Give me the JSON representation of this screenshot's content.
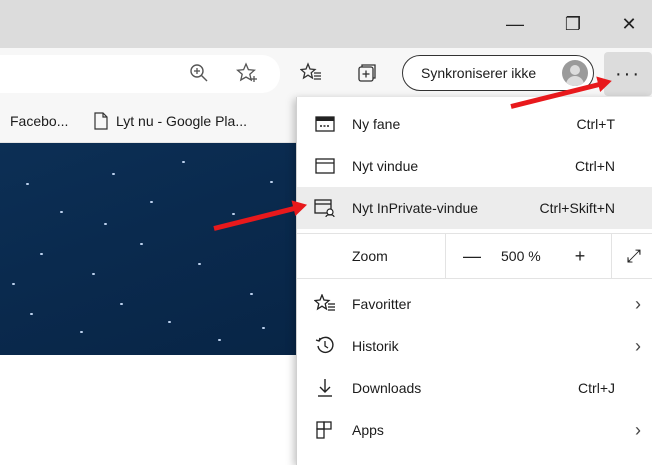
{
  "window": {
    "minimize_symbol": "—",
    "restore_symbol": "❐",
    "close_symbol": "✕"
  },
  "toolbar": {
    "zoom_icon": "zoom-in-icon",
    "favorite_icon": "add-favorite-icon",
    "favorites_icon": "favorites-icon",
    "collections_icon": "collections-icon",
    "sync_label": "Synkroniserer ikke",
    "more_label": "···"
  },
  "favorites_bar": [
    {
      "label": "Facebo..."
    },
    {
      "label": "Lyt nu - Google Pla..."
    }
  ],
  "menu": {
    "items": [
      {
        "label": "Ny fane",
        "shortcut": "Ctrl+T",
        "icon": "new-tab-icon"
      },
      {
        "label": "Nyt vindue",
        "shortcut": "Ctrl+N",
        "icon": "new-window-icon"
      },
      {
        "label": "Nyt InPrivate-vindue",
        "shortcut": "Ctrl+Skift+N",
        "icon": "inprivate-icon",
        "highlighted": true
      }
    ],
    "zoom": {
      "label": "Zoom",
      "minus": "—",
      "value": "500 %",
      "plus": "+",
      "fullscreen": "⤢"
    },
    "items2": [
      {
        "label": "Favoritter",
        "icon": "favorites-icon",
        "chevron": "›"
      },
      {
        "label": "Historik",
        "icon": "history-icon",
        "chevron": "›"
      },
      {
        "label": "Downloads",
        "shortcut": "Ctrl+J",
        "icon": "download-icon"
      },
      {
        "label": "Apps",
        "icon": "apps-icon",
        "chevron": "›"
      }
    ]
  },
  "colors": {
    "annotation_arrow": "#e8191c",
    "titlebar": "#dcdcdc",
    "page_background": "#0a2a4e"
  }
}
